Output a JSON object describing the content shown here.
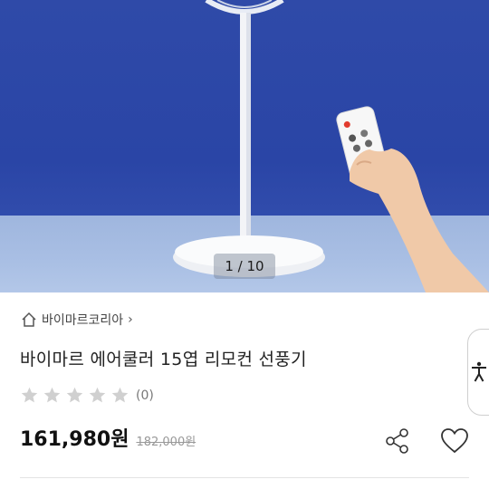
{
  "gallery": {
    "counter": "1 / 10"
  },
  "seller": {
    "name": "바이마르코리아"
  },
  "product": {
    "title": "바이마르 에어쿨러 15엽 리모컨 선풍기",
    "rating_stars": 0,
    "review_count": "(0)",
    "price": "161,980원",
    "original_price": "182,000원"
  },
  "icons": {
    "home": "home-icon",
    "chevron": "chevron-right-icon",
    "share": "share-icon",
    "like": "heart-icon",
    "accessibility": "accessibility-icon"
  },
  "colors": {
    "background_blue": "#2f4aa8",
    "table_blue": "#a9bfe4",
    "star_empty": "#d0d0d0"
  }
}
